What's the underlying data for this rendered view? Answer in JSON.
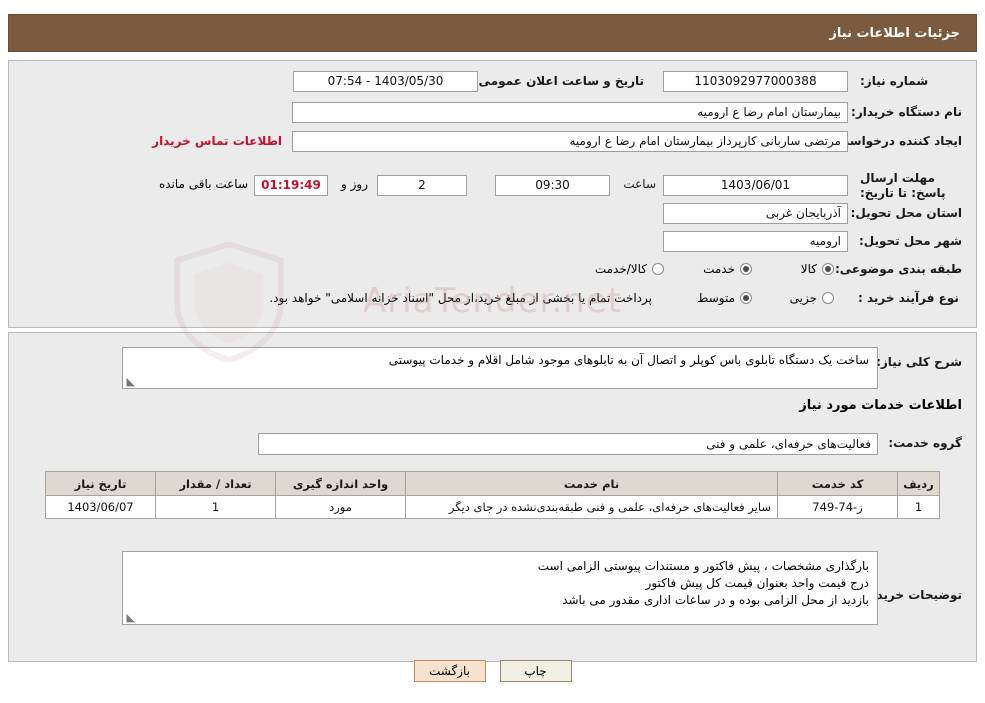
{
  "header": {
    "title": "جزئیات اطلاعات نیاز"
  },
  "form": {
    "need_number_label": "شماره نیاز:",
    "need_number_value": "1103092977000388",
    "announce_datetime_label": "تاریخ و ساعت اعلان عمومی:",
    "announce_datetime_value": "1403/05/30 - 07:54",
    "buyer_org_label": "نام دستگاه خریدار:",
    "buyer_org_value": "بیمارستان امام رضا  ع  ارومیه",
    "requester_label": "ایجاد کننده درخواست:",
    "requester_value": "مرتضی ساربانی کارپرداز بیمارستان امام رضا  ع  ارومیه",
    "contact_link": "اطلاعات تماس خریدار",
    "deadline_label": "مهلت ارسال پاسخ: تا تاریخ:",
    "deadline_date": "1403/06/01",
    "time_label": "ساعت",
    "deadline_time": "09:30",
    "days_value": "2",
    "days_label": "روز و",
    "countdown_value": "01:19:49",
    "remaining_label": "ساعت باقی مانده",
    "province_label": "استان محل تحویل:",
    "province_value": "آذربایجان غربی",
    "city_label": "شهر محل تحویل:",
    "city_value": "ارومیه",
    "category_label": "طبقه بندی موضوعی:",
    "category_options": [
      {
        "label": "کالا",
        "selected": true
      },
      {
        "label": "خدمت",
        "selected": true
      },
      {
        "label": "کالا/خدمت",
        "selected": false
      }
    ],
    "process_label": "نوع فرآیند خرید :",
    "process_options": [
      {
        "label": "جزیی",
        "selected": false
      },
      {
        "label": "متوسط",
        "selected": true
      }
    ],
    "process_note": "پرداخت تمام یا بخشی از مبلغ خرید،از محل \"اسناد خزانه اسلامی\" خواهد بود."
  },
  "watermark": {
    "text": "AriaTender.net"
  },
  "detail": {
    "general_desc_label": "شرح کلی نیاز:",
    "general_desc_value": "ساخت یک دستگاه تابلوی باس کوپلر و اتصال آن به تابلوهای موجود شامل اقلام و خدمات پیوستی",
    "services_info_title": "اطلاعات خدمات مورد نیاز",
    "service_group_label": "گروه خدمت:",
    "service_group_value": "فعالیت‌های حرفه‌ای، علمی و فنی"
  },
  "table": {
    "columns": [
      "ردیف",
      "کد خدمت",
      "نام خدمت",
      "واحد اندازه گیری",
      "تعداد / مقدار",
      "تاریخ نیاز"
    ],
    "rows": [
      {
        "row_no": "1",
        "code": "ز-74-749",
        "name": "سایر فعالیت‌های حرفه‌ای، علمی و فنی طبقه‌بندی‌نشده در جای دیگر",
        "unit": "مورد",
        "qty": "1",
        "date": "1403/06/07"
      }
    ]
  },
  "buyer_notes": {
    "label": "توضیحات خریدار:",
    "lines": [
      "بارگذاری مشخصات ، پیش فاکتور و مستندات پیوستی الزامی است",
      "درج قیمت واحد بعنوان قیمت کل پیش فاکتور",
      "بازدید از محل الزامی بوده و در ساعات اداری مقدور می باشد"
    ]
  },
  "footer": {
    "back_button": "بازگشت",
    "print_button": "چاپ"
  }
}
